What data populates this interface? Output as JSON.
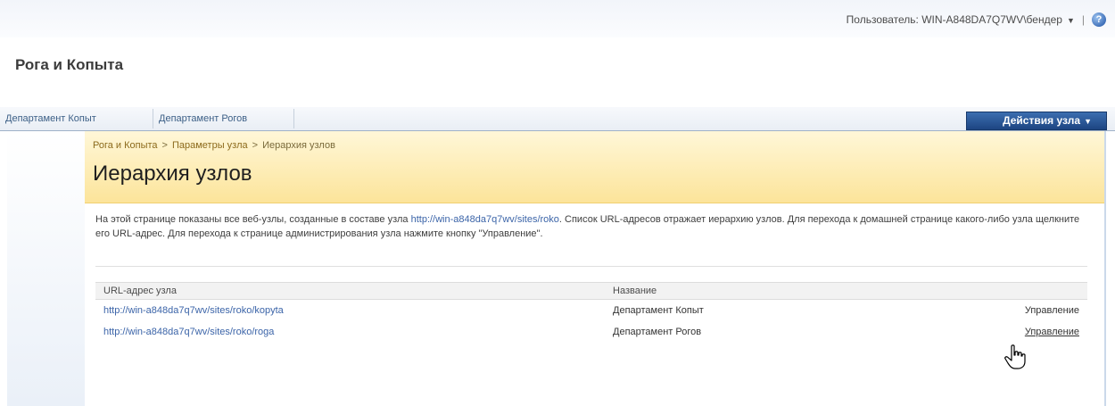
{
  "header": {
    "user_label": "Пользователь: WIN-A848DA7Q7WV\\бендер",
    "separator": "|",
    "site_title": "Рога и Копыта"
  },
  "nav": {
    "tabs": [
      {
        "label": "Департамент Копыт"
      },
      {
        "label": "Департамент Рогов"
      }
    ],
    "site_actions": "Действия узла"
  },
  "breadcrumb": {
    "items": [
      "Рога и Копыта",
      "Параметры узла",
      "Иерархия узлов"
    ],
    "separator": ">"
  },
  "page_title": "Иерархия узлов",
  "description": {
    "part1": "На этой странице показаны все веб-узлы, созданные в составе узла ",
    "link": "http://win-a848da7q7wv/sites/roko",
    "part2": ". Список URL-адресов отражает иерархию узлов. Для перехода к домашней странице какого-либо узла щелкните его URL-адрес. Для перехода к странице администрирования узла нажмите кнопку \"Управление\"."
  },
  "table": {
    "headers": [
      "URL-адрес узла",
      "Название",
      ""
    ],
    "rows": [
      {
        "url": "http://win-a848da7q7wv/sites/roko/kopyta",
        "name": "Департамент Копыт",
        "action": "Управление"
      },
      {
        "url": "http://win-a848da7q7wv/sites/roko/roga",
        "name": "Департамент Рогов",
        "action": "Управление"
      }
    ]
  },
  "icons": {
    "help": "help-icon",
    "user_menu_arrow": "chevron-down-icon",
    "cursor": "hand-cursor-icon"
  },
  "colors": {
    "site_actions_bg": "#2b5797",
    "title_area_bg": "#fce9a8",
    "link": "#3b64a8"
  }
}
